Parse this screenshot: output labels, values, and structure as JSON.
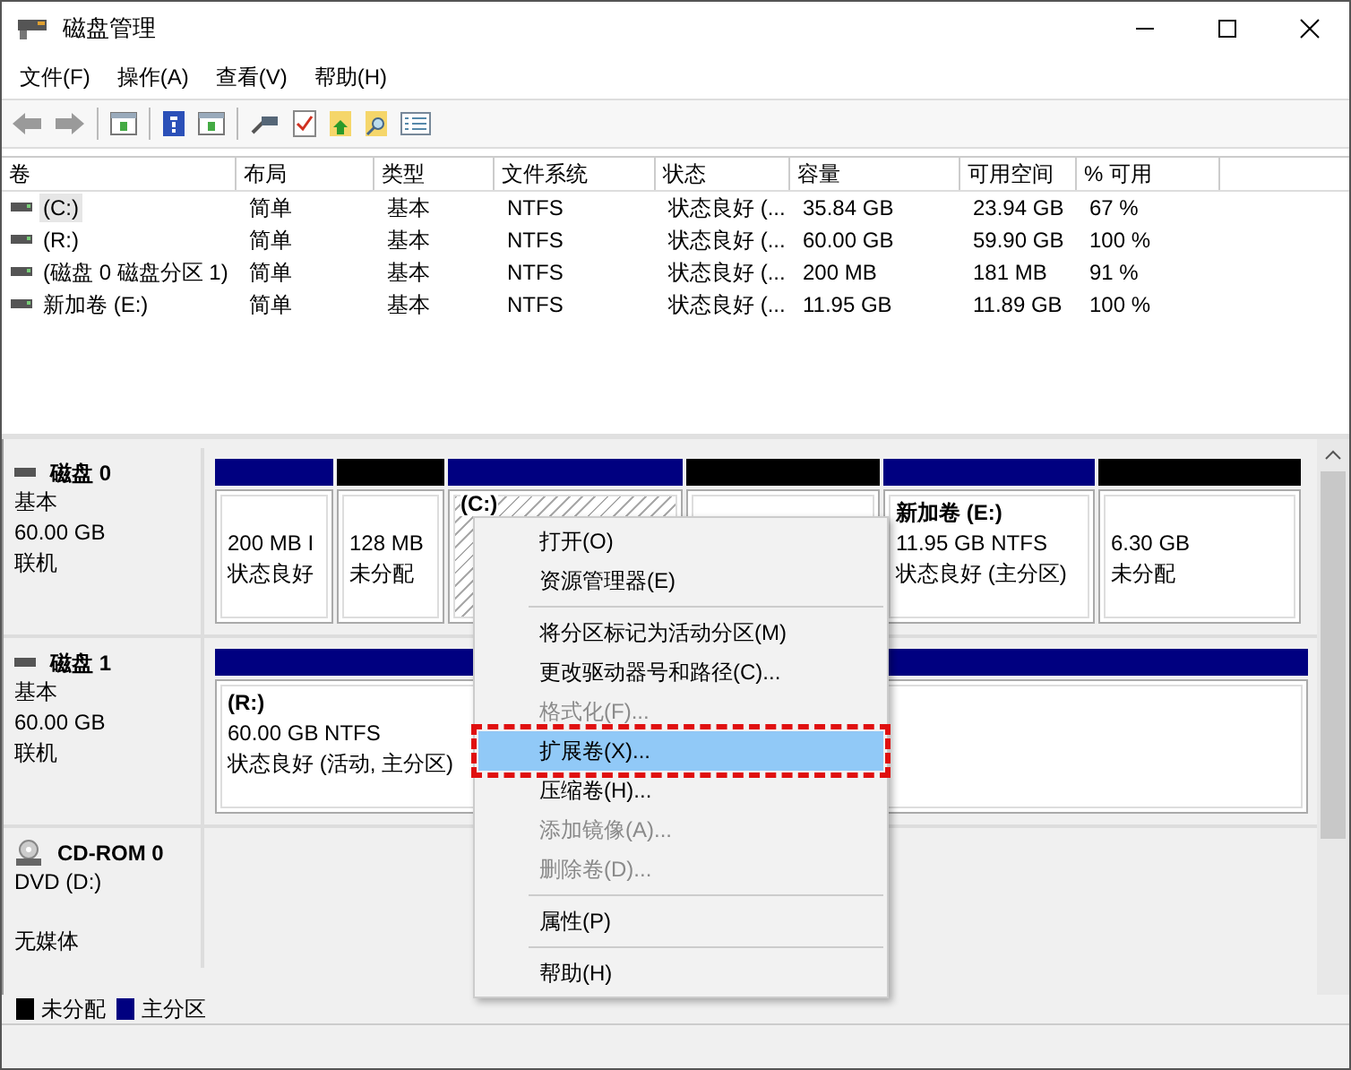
{
  "window": {
    "title": "磁盘管理"
  },
  "menu_bar": [
    "文件(F)",
    "操作(A)",
    "查看(V)",
    "帮助(H)"
  ],
  "table": {
    "columns": [
      "卷",
      "布局",
      "类型",
      "文件系统",
      "状态",
      "容量",
      "可用空间",
      "% 可用"
    ],
    "rows": [
      {
        "cells": [
          "(C:)",
          "简单",
          "基本",
          "NTFS",
          "状态良好 (...",
          "35.84 GB",
          "23.94 GB",
          "67 %"
        ],
        "selected": true
      },
      {
        "cells": [
          "(R:)",
          "简单",
          "基本",
          "NTFS",
          "状态良好 (...",
          "60.00 GB",
          "59.90 GB",
          "100 %"
        ],
        "selected": false
      },
      {
        "cells": [
          "(磁盘 0 磁盘分区 1)",
          "简单",
          "基本",
          "NTFS",
          "状态良好 (...",
          "200 MB",
          "181 MB",
          "91 %"
        ],
        "selected": false
      },
      {
        "cells": [
          "新加卷 (E:)",
          "简单",
          "基本",
          "NTFS",
          "状态良好 (...",
          "11.95 GB",
          "11.89 GB",
          "100 %"
        ],
        "selected": false
      }
    ]
  },
  "disks": [
    {
      "kind": "disk",
      "name": "磁盘 0",
      "lines": [
        "基本",
        "60.00 GB",
        "联机"
      ],
      "partitions": [
        {
          "kind": "primary",
          "lines": [
            "200 MB I",
            "状态良好"
          ],
          "selected": false
        },
        {
          "kind": "unallocated",
          "lines": [
            "128 MB",
            "未分配"
          ],
          "selected": false
        },
        {
          "kind": "primary",
          "title": "(C:)",
          "selected": true
        },
        {
          "kind": "unallocated",
          "selected": false
        },
        {
          "kind": "primary",
          "title": "新加卷  (E:)",
          "lines": [
            "11.95 GB NTFS",
            "状态良好 (主分区)"
          ],
          "selected": false
        },
        {
          "kind": "unallocated",
          "lines": [
            "6.30 GB",
            "未分配"
          ],
          "selected": false
        }
      ]
    },
    {
      "kind": "disk",
      "name": "磁盘 1",
      "lines": [
        "基本",
        "60.00 GB",
        "联机"
      ],
      "partitions": [
        {
          "kind": "primary",
          "title": "(R:)",
          "lines": [
            "60.00 GB NTFS",
            "状态良好 (活动, 主分区)"
          ],
          "selected": false
        }
      ]
    },
    {
      "kind": "cdrom",
      "name": "CD-ROM 0",
      "lines": [
        "DVD (D:)"
      ],
      "footer": "无媒体"
    }
  ],
  "legend": [
    {
      "label": "未分配",
      "color": "#000000"
    },
    {
      "label": "主分区",
      "color": "#000080"
    }
  ],
  "context_menu": {
    "items": [
      {
        "kind": "item",
        "label": "打开(O)",
        "disabled": false,
        "selected": false
      },
      {
        "kind": "item",
        "label": "资源管理器(E)",
        "disabled": false,
        "selected": false
      },
      {
        "kind": "separator"
      },
      {
        "kind": "item",
        "label": "将分区标记为活动分区(M)",
        "disabled": false,
        "selected": false
      },
      {
        "kind": "item",
        "label": "更改驱动器号和路径(C)...",
        "disabled": false,
        "selected": false
      },
      {
        "kind": "item",
        "label": "格式化(F)...",
        "disabled": true,
        "selected": false
      },
      {
        "kind": "item",
        "label": "扩展卷(X)...",
        "disabled": false,
        "selected": true
      },
      {
        "kind": "item",
        "label": "压缩卷(H)...",
        "disabled": false,
        "selected": false
      },
      {
        "kind": "item",
        "label": "添加镜像(A)...",
        "disabled": true,
        "selected": false
      },
      {
        "kind": "item",
        "label": "删除卷(D)...",
        "disabled": true,
        "selected": false
      },
      {
        "kind": "separator"
      },
      {
        "kind": "item",
        "label": "属性(P)",
        "disabled": false,
        "selected": false
      },
      {
        "kind": "separator"
      },
      {
        "kind": "item",
        "label": "帮助(H)",
        "disabled": false,
        "selected": false
      }
    ]
  }
}
